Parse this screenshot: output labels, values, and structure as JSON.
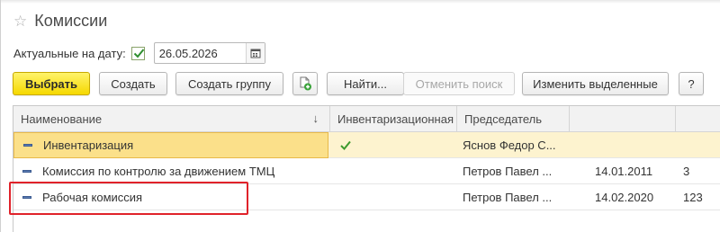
{
  "window": {
    "title": "Комиссии",
    "star_icon": "star-icon"
  },
  "filter": {
    "date_label": "Актуальные на дату:",
    "date_checked": true,
    "date_value": "26.05.2026",
    "calendar_icon": "calendar-icon"
  },
  "toolbar": {
    "select_label": "Выбрать",
    "create_label": "Создать",
    "create_group_label": "Создать группу",
    "copy_icon": "copy-add-icon",
    "find_label": "Найти...",
    "cancel_search_label": "Отменить поиск",
    "change_selected_label": "Изменить выделенные",
    "help_label": "?"
  },
  "table": {
    "columns": [
      "Наименование",
      "Инвентаризационная",
      "Председатель",
      "",
      ""
    ],
    "sort_indicator": "↓",
    "rows": [
      {
        "name": "Инвентаризация",
        "inventory": true,
        "chairman": "Яснов Федор С...",
        "date": "",
        "number": "",
        "selected": true
      },
      {
        "name": "Комиссия по контролю за движением ТМЦ",
        "inventory": false,
        "chairman": "Петров Павел ...",
        "date": "14.01.2011",
        "number": "3",
        "selected": false
      },
      {
        "name": "Рабочая комиссия",
        "inventory": false,
        "chairman": "Петров Павел ...",
        "date": "14.02.2020",
        "number": "123",
        "selected": false
      }
    ]
  },
  "colors": {
    "accent_yellow": "#f5d800",
    "selected_row": "#fdf3cf",
    "highlight_red": "#e0222a",
    "check_green": "#3c9a2e"
  }
}
